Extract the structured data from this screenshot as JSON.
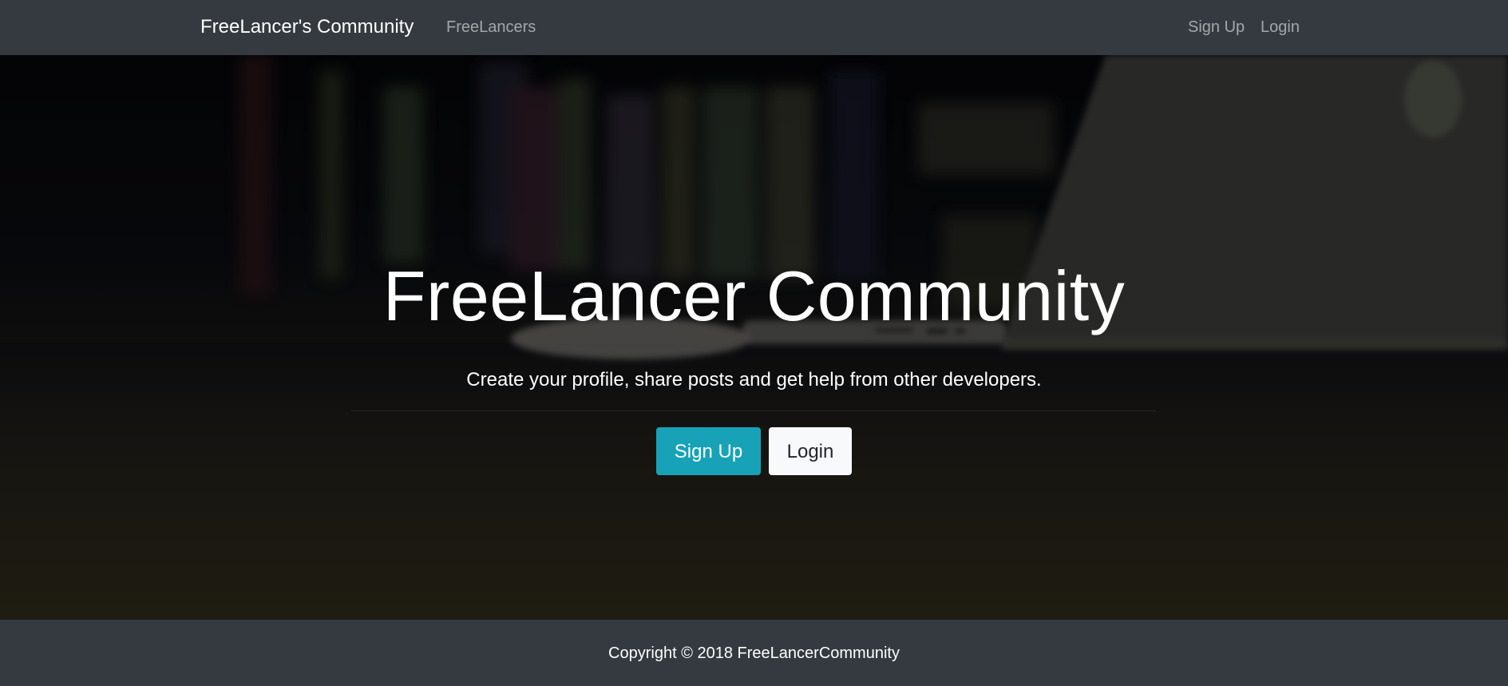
{
  "navbar": {
    "brand": "FreeLancer's Community",
    "links": {
      "freelancers": "FreeLancers",
      "signup": "Sign Up",
      "login": "Login"
    }
  },
  "hero": {
    "title": "FreeLancer Community",
    "lead": "Create your profile, share posts and get help from other developers.",
    "buttons": {
      "signup": "Sign Up",
      "login": "Login"
    }
  },
  "footer": {
    "copyright": "Copyright © 2018 FreeLancerCommunity"
  },
  "colors": {
    "navbar_bg": "#343a40",
    "signup_button": "#17a2b8",
    "login_button": "#f8f9fa",
    "footer_bg": "#343a40"
  }
}
